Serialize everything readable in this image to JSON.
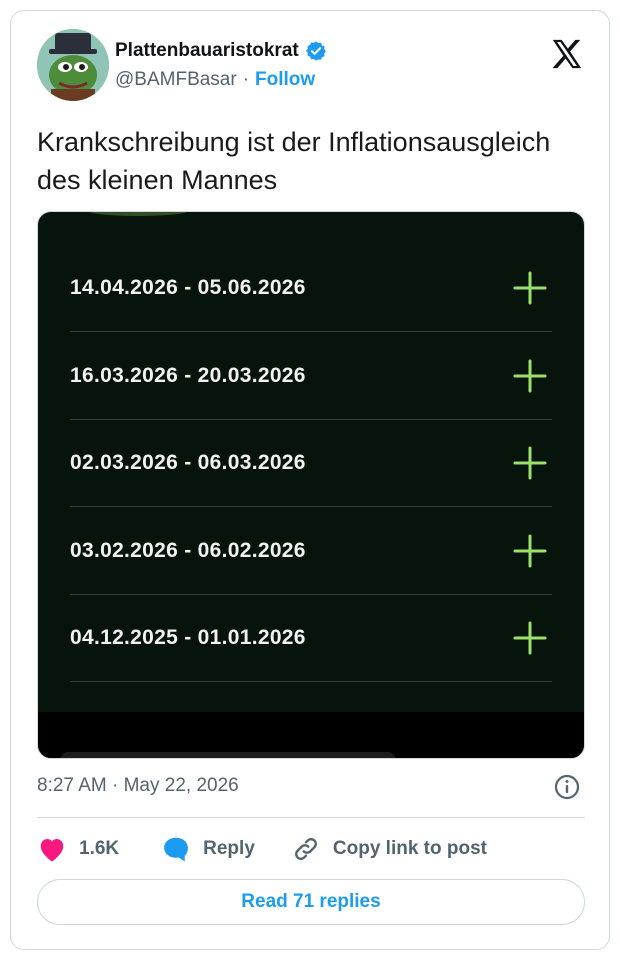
{
  "author": {
    "display_name": "Plattenbauaristokrat",
    "handle": "@BAMFBasar",
    "separator": "·",
    "follow_label": "Follow"
  },
  "tweet": {
    "text": "Krankschreibung ist der Inflationsausgleich des kleinen Mannes"
  },
  "media": {
    "date_ranges": [
      "14.04.2026 - 05.06.2026",
      "16.03.2026 - 20.03.2026",
      "02.03.2026 - 06.03.2026",
      "03.02.2026 - 06.02.2026",
      "04.12.2025 - 01.01.2026"
    ],
    "plus_icon": "plus-icon",
    "plus_color": "#9be06a",
    "background_color": "#07140b"
  },
  "meta": {
    "timestamp": "8:27 AM · May 22, 2026"
  },
  "actions": {
    "like_count": "1.6K",
    "reply_label": "Reply",
    "copy_label": "Copy link to post"
  },
  "footer": {
    "read_replies_label": "Read 71 replies"
  },
  "colors": {
    "accent": "#1d9bf0",
    "like": "#f91880",
    "secondary_text": "#536471"
  }
}
